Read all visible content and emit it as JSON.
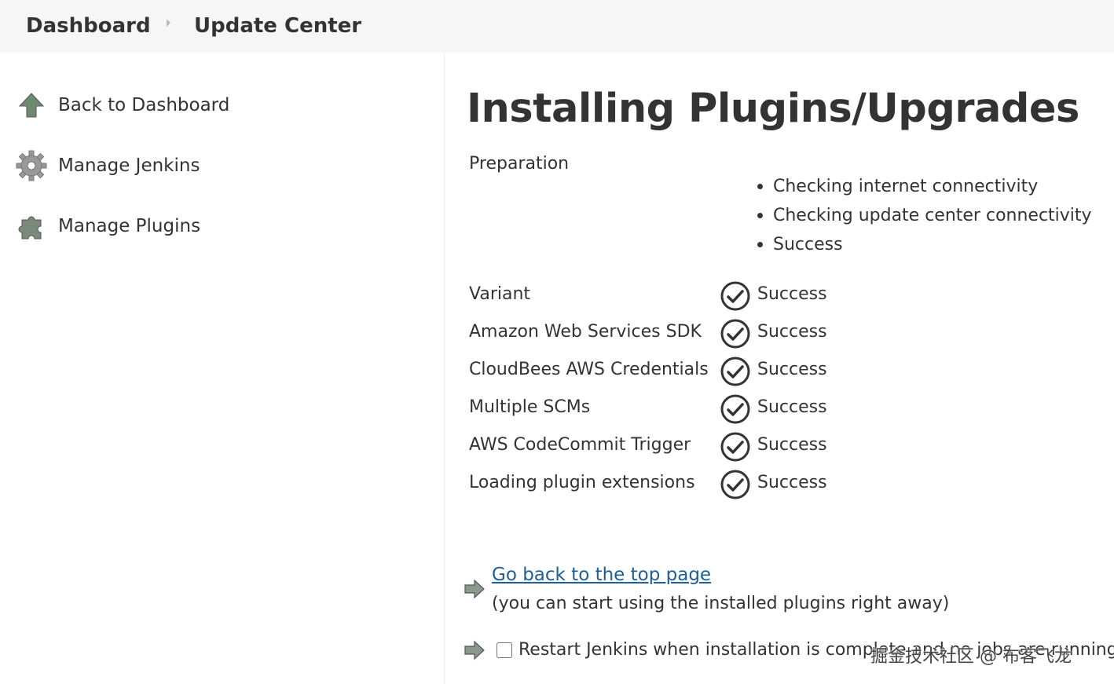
{
  "breadcrumb": {
    "dashboard": "Dashboard",
    "update_center": "Update Center"
  },
  "sidebar": {
    "items": [
      {
        "label": "Back to Dashboard",
        "icon": "up-arrow-icon"
      },
      {
        "label": "Manage Jenkins",
        "icon": "gear-icon"
      },
      {
        "label": "Manage Plugins",
        "icon": "puzzle-icon"
      }
    ]
  },
  "main": {
    "title": "Installing Plugins/Upgrades",
    "preparation": {
      "label": "Preparation",
      "steps": [
        "Checking internet connectivity",
        "Checking update center connectivity",
        "Success"
      ]
    },
    "plugins": [
      {
        "name": "Variant",
        "status": "Success"
      },
      {
        "name": "Amazon Web Services SDK",
        "status": "Success"
      },
      {
        "name": "CloudBees AWS Credentials",
        "status": "Success"
      },
      {
        "name": "Multiple SCMs",
        "status": "Success"
      },
      {
        "name": "AWS CodeCommit Trigger",
        "status": "Success"
      },
      {
        "name": "Loading plugin extensions",
        "status": "Success"
      }
    ],
    "go_back_link": "Go back to the top page",
    "go_back_note": "(you can start using the installed plugins right away)",
    "restart_label": "Restart Jenkins when installation is complete and no jobs are running",
    "restart_checked": false
  },
  "watermark": "掘金技术社区 @ 布客飞龙",
  "colors": {
    "link": "#1e5f97",
    "topbar": "#f6f6f6",
    "icon_gray": "#777777"
  }
}
